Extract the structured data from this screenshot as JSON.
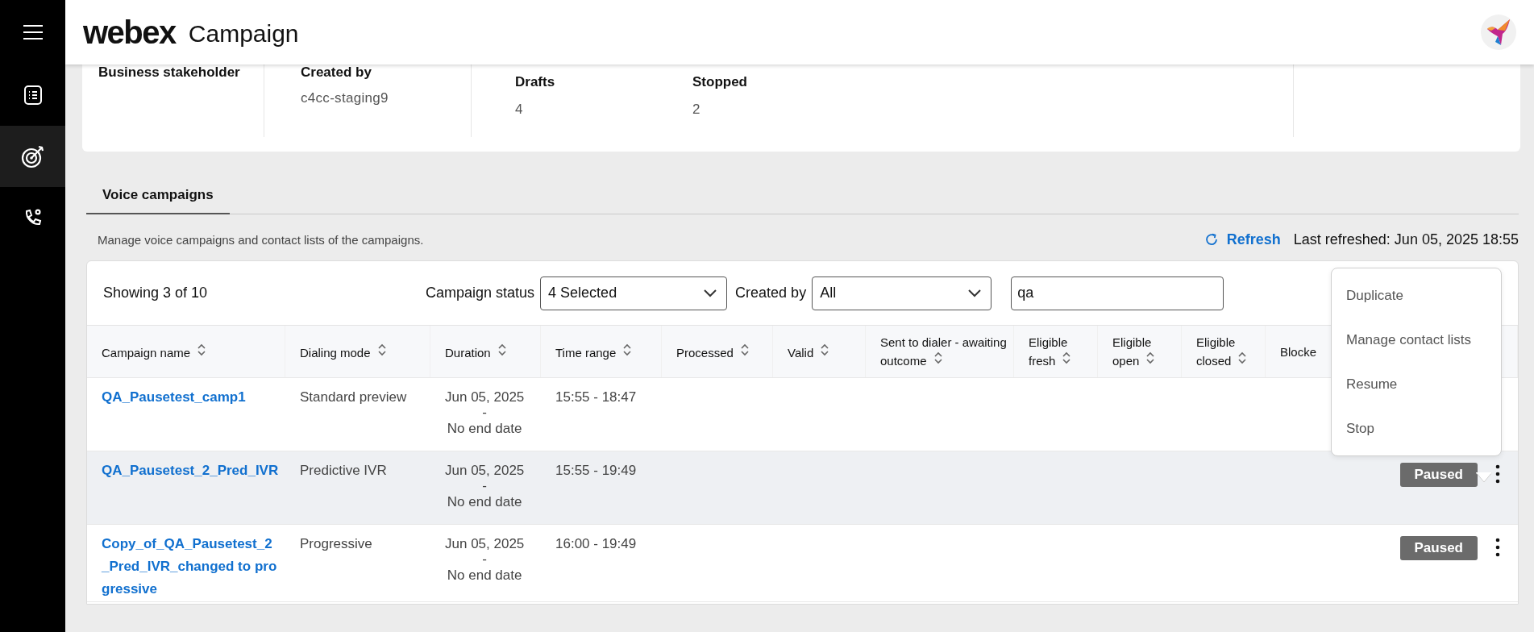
{
  "sidebar": {
    "items": [
      {
        "kind": "menu",
        "selected": false
      },
      {
        "kind": "list",
        "selected": false
      },
      {
        "kind": "target",
        "selected": true
      },
      {
        "kind": "phone",
        "selected": false
      }
    ]
  },
  "header": {
    "logo": "webex",
    "title": "Campaign"
  },
  "summary": {
    "stakeholder": {
      "label": "Business stakeholder"
    },
    "created_by": {
      "label": "Created by",
      "value": "c4cc-staging9"
    },
    "stats": [
      {
        "label": "Drafts",
        "value": "4"
      },
      {
        "label": "Stopped",
        "value": "2"
      }
    ]
  },
  "tabs": [
    {
      "label": "Voice campaigns",
      "selected": true
    }
  ],
  "description": "Manage voice campaigns and contact lists of the campaigns.",
  "refresh": {
    "label": "Refresh"
  },
  "last_refreshed": "Last refreshed: Jun 05, 2025 18:55",
  "table": {
    "showing": "Showing 3 of 10",
    "filters": [
      {
        "label": "Campaign status",
        "value": "4 Selected"
      },
      {
        "label": "Created by",
        "value": "All"
      }
    ],
    "search": {
      "value": "qa"
    },
    "columns": [
      {
        "label": "Campaign name",
        "sortable": true
      },
      {
        "label": "Dialing mode",
        "sortable": true
      },
      {
        "label": "Duration",
        "sortable": true
      },
      {
        "label": "Time range",
        "sortable": true
      },
      {
        "label": "Processed",
        "sortable": true
      },
      {
        "label": "Valid",
        "sortable": true
      },
      {
        "label": "Sent to dialer - awaiting outcome",
        "sortable": true
      },
      {
        "label": "Eligible fresh",
        "sortable": true
      },
      {
        "label": "Eligible open",
        "sortable": true
      },
      {
        "label": "Eligible closed",
        "sortable": true
      },
      {
        "label": "Blocke",
        "sortable": false
      }
    ],
    "rows": [
      {
        "name": "QA_Pausetest_camp1",
        "dialing_mode": "Standard preview",
        "duration_start": "Jun 05, 2025",
        "duration_sep": "-",
        "duration_end": "No end date",
        "time_range": "15:55 - 18:47",
        "selected": false
      },
      {
        "name": "QA_Pausetest_2_Pred_IVR",
        "dialing_mode": "Predictive IVR",
        "duration_start": "Jun 05, 2025",
        "duration_sep": "-",
        "duration_end": "No end date",
        "time_range": "15:55 - 19:49",
        "status": "Paused",
        "selected": true
      },
      {
        "name": "Copy_of_QA_Pausetest_2_Pred_IVR_changed to progressive",
        "dialing_mode": "Progressive",
        "duration_start": "Jun 05, 2025",
        "duration_sep": "-",
        "duration_end": "No end date",
        "time_range": "16:00 - 19:49",
        "status": "Paused",
        "selected": false
      }
    ],
    "menu": {
      "items": [
        "Duplicate",
        "Manage contact lists",
        "Resume",
        "Stop"
      ]
    }
  }
}
